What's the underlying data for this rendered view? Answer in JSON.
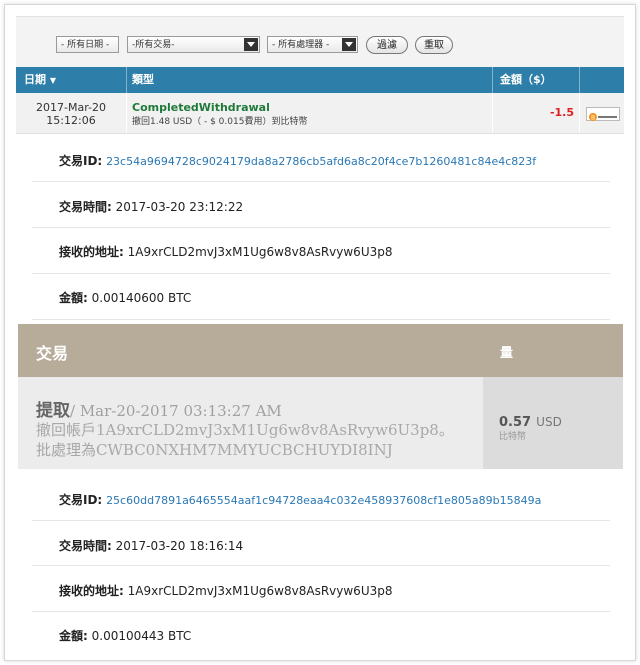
{
  "filters": {
    "date_button": "- 所有日期 -",
    "transaction_select": "-所有交易-",
    "processor_select": "- 所有處理器 -",
    "filter_button": "過濾",
    "reset_button": "重取"
  },
  "table": {
    "headers": {
      "date": "日期",
      "type": "類型",
      "amount": "金額（$）"
    },
    "row": {
      "date": "2017-Mar-20",
      "time": "15:12:06",
      "type_title": "CompletedWithdrawal",
      "type_desc": "撤回1.48 USD（ - $ 0.015費用）到比特幣",
      "amount": "-1.5",
      "processor_logo": "bitcoin"
    }
  },
  "detail1": {
    "txid_label": "交易ID:",
    "txid": "23c54a9694728c9024179da8a2786cb5afd6a8c20f4ce7b1260481c84e4c823f",
    "time_label": "交易時間:",
    "time": "2017-03-20 23:12:22",
    "addr_label": "接收的地址:",
    "addr": "1A9xrCLD2mvJ3xM1Ug6w8v8AsRvyw6U3p8",
    "amount_label": "金額:",
    "amount": "0.00140600 BTC"
  },
  "band": {
    "col_transaction": "交易",
    "col_amount": "量",
    "title": "提取",
    "timestamp": "/ Mar-20-2017 03:13:27 AM",
    "desc_line1": "撤回帳戶1A9xrCLD2mvJ3xM1Ug6w8v8AsRvyw6U3p8。",
    "desc_line2": "批處理為CWBC0NXHM7MMYUCBCHUYDI8INJ",
    "amount_value": "0.57",
    "amount_unit": "USD",
    "amount_sub": "比特幣"
  },
  "detail2": {
    "txid_label": "交易ID:",
    "txid": "25c60dd7891a6465554aaf1c94728eaa4c032e458937608cf1e805a89b15849a",
    "time_label": "交易時間:",
    "time": "2017-03-20 18:16:14",
    "addr_label": "接收的地址:",
    "addr": "1A9xrCLD2mvJ3xM1Ug6w8v8AsRvyw6U3p8",
    "amount_label": "金額:",
    "amount": "0.00100443 BTC"
  },
  "colors": {
    "header": "#2d7ea8",
    "link": "#2a78b5",
    "negative": "#e02020",
    "band": "#b7ab9a"
  }
}
